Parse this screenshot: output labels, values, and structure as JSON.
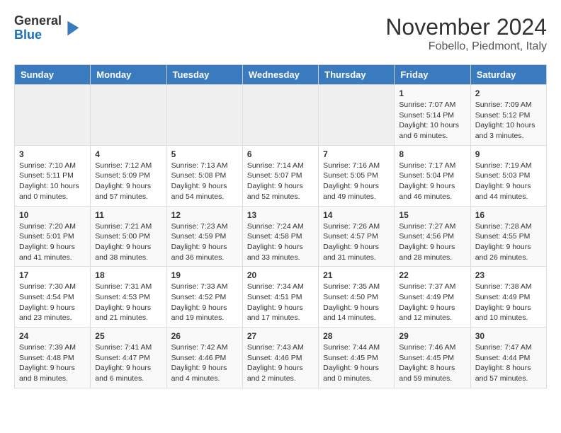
{
  "logo": {
    "general": "General",
    "blue": "Blue"
  },
  "title": "November 2024",
  "subtitle": "Fobello, Piedmont, Italy",
  "headers": [
    "Sunday",
    "Monday",
    "Tuesday",
    "Wednesday",
    "Thursday",
    "Friday",
    "Saturday"
  ],
  "weeks": [
    [
      {
        "day": "",
        "info": ""
      },
      {
        "day": "",
        "info": ""
      },
      {
        "day": "",
        "info": ""
      },
      {
        "day": "",
        "info": ""
      },
      {
        "day": "",
        "info": ""
      },
      {
        "day": "1",
        "info": "Sunrise: 7:07 AM\nSunset: 5:14 PM\nDaylight: 10 hours\nand 6 minutes."
      },
      {
        "day": "2",
        "info": "Sunrise: 7:09 AM\nSunset: 5:12 PM\nDaylight: 10 hours\nand 3 minutes."
      }
    ],
    [
      {
        "day": "3",
        "info": "Sunrise: 7:10 AM\nSunset: 5:11 PM\nDaylight: 10 hours\nand 0 minutes."
      },
      {
        "day": "4",
        "info": "Sunrise: 7:12 AM\nSunset: 5:09 PM\nDaylight: 9 hours\nand 57 minutes."
      },
      {
        "day": "5",
        "info": "Sunrise: 7:13 AM\nSunset: 5:08 PM\nDaylight: 9 hours\nand 54 minutes."
      },
      {
        "day": "6",
        "info": "Sunrise: 7:14 AM\nSunset: 5:07 PM\nDaylight: 9 hours\nand 52 minutes."
      },
      {
        "day": "7",
        "info": "Sunrise: 7:16 AM\nSunset: 5:05 PM\nDaylight: 9 hours\nand 49 minutes."
      },
      {
        "day": "8",
        "info": "Sunrise: 7:17 AM\nSunset: 5:04 PM\nDaylight: 9 hours\nand 46 minutes."
      },
      {
        "day": "9",
        "info": "Sunrise: 7:19 AM\nSunset: 5:03 PM\nDaylight: 9 hours\nand 44 minutes."
      }
    ],
    [
      {
        "day": "10",
        "info": "Sunrise: 7:20 AM\nSunset: 5:01 PM\nDaylight: 9 hours\nand 41 minutes."
      },
      {
        "day": "11",
        "info": "Sunrise: 7:21 AM\nSunset: 5:00 PM\nDaylight: 9 hours\nand 38 minutes."
      },
      {
        "day": "12",
        "info": "Sunrise: 7:23 AM\nSunset: 4:59 PM\nDaylight: 9 hours\nand 36 minutes."
      },
      {
        "day": "13",
        "info": "Sunrise: 7:24 AM\nSunset: 4:58 PM\nDaylight: 9 hours\nand 33 minutes."
      },
      {
        "day": "14",
        "info": "Sunrise: 7:26 AM\nSunset: 4:57 PM\nDaylight: 9 hours\nand 31 minutes."
      },
      {
        "day": "15",
        "info": "Sunrise: 7:27 AM\nSunset: 4:56 PM\nDaylight: 9 hours\nand 28 minutes."
      },
      {
        "day": "16",
        "info": "Sunrise: 7:28 AM\nSunset: 4:55 PM\nDaylight: 9 hours\nand 26 minutes."
      }
    ],
    [
      {
        "day": "17",
        "info": "Sunrise: 7:30 AM\nSunset: 4:54 PM\nDaylight: 9 hours\nand 23 minutes."
      },
      {
        "day": "18",
        "info": "Sunrise: 7:31 AM\nSunset: 4:53 PM\nDaylight: 9 hours\nand 21 minutes."
      },
      {
        "day": "19",
        "info": "Sunrise: 7:33 AM\nSunset: 4:52 PM\nDaylight: 9 hours\nand 19 minutes."
      },
      {
        "day": "20",
        "info": "Sunrise: 7:34 AM\nSunset: 4:51 PM\nDaylight: 9 hours\nand 17 minutes."
      },
      {
        "day": "21",
        "info": "Sunrise: 7:35 AM\nSunset: 4:50 PM\nDaylight: 9 hours\nand 14 minutes."
      },
      {
        "day": "22",
        "info": "Sunrise: 7:37 AM\nSunset: 4:49 PM\nDaylight: 9 hours\nand 12 minutes."
      },
      {
        "day": "23",
        "info": "Sunrise: 7:38 AM\nSunset: 4:49 PM\nDaylight: 9 hours\nand 10 minutes."
      }
    ],
    [
      {
        "day": "24",
        "info": "Sunrise: 7:39 AM\nSunset: 4:48 PM\nDaylight: 9 hours\nand 8 minutes."
      },
      {
        "day": "25",
        "info": "Sunrise: 7:41 AM\nSunset: 4:47 PM\nDaylight: 9 hours\nand 6 minutes."
      },
      {
        "day": "26",
        "info": "Sunrise: 7:42 AM\nSunset: 4:46 PM\nDaylight: 9 hours\nand 4 minutes."
      },
      {
        "day": "27",
        "info": "Sunrise: 7:43 AM\nSunset: 4:46 PM\nDaylight: 9 hours\nand 2 minutes."
      },
      {
        "day": "28",
        "info": "Sunrise: 7:44 AM\nSunset: 4:45 PM\nDaylight: 9 hours\nand 0 minutes."
      },
      {
        "day": "29",
        "info": "Sunrise: 7:46 AM\nSunset: 4:45 PM\nDaylight: 8 hours\nand 59 minutes."
      },
      {
        "day": "30",
        "info": "Sunrise: 7:47 AM\nSunset: 4:44 PM\nDaylight: 8 hours\nand 57 minutes."
      }
    ]
  ]
}
